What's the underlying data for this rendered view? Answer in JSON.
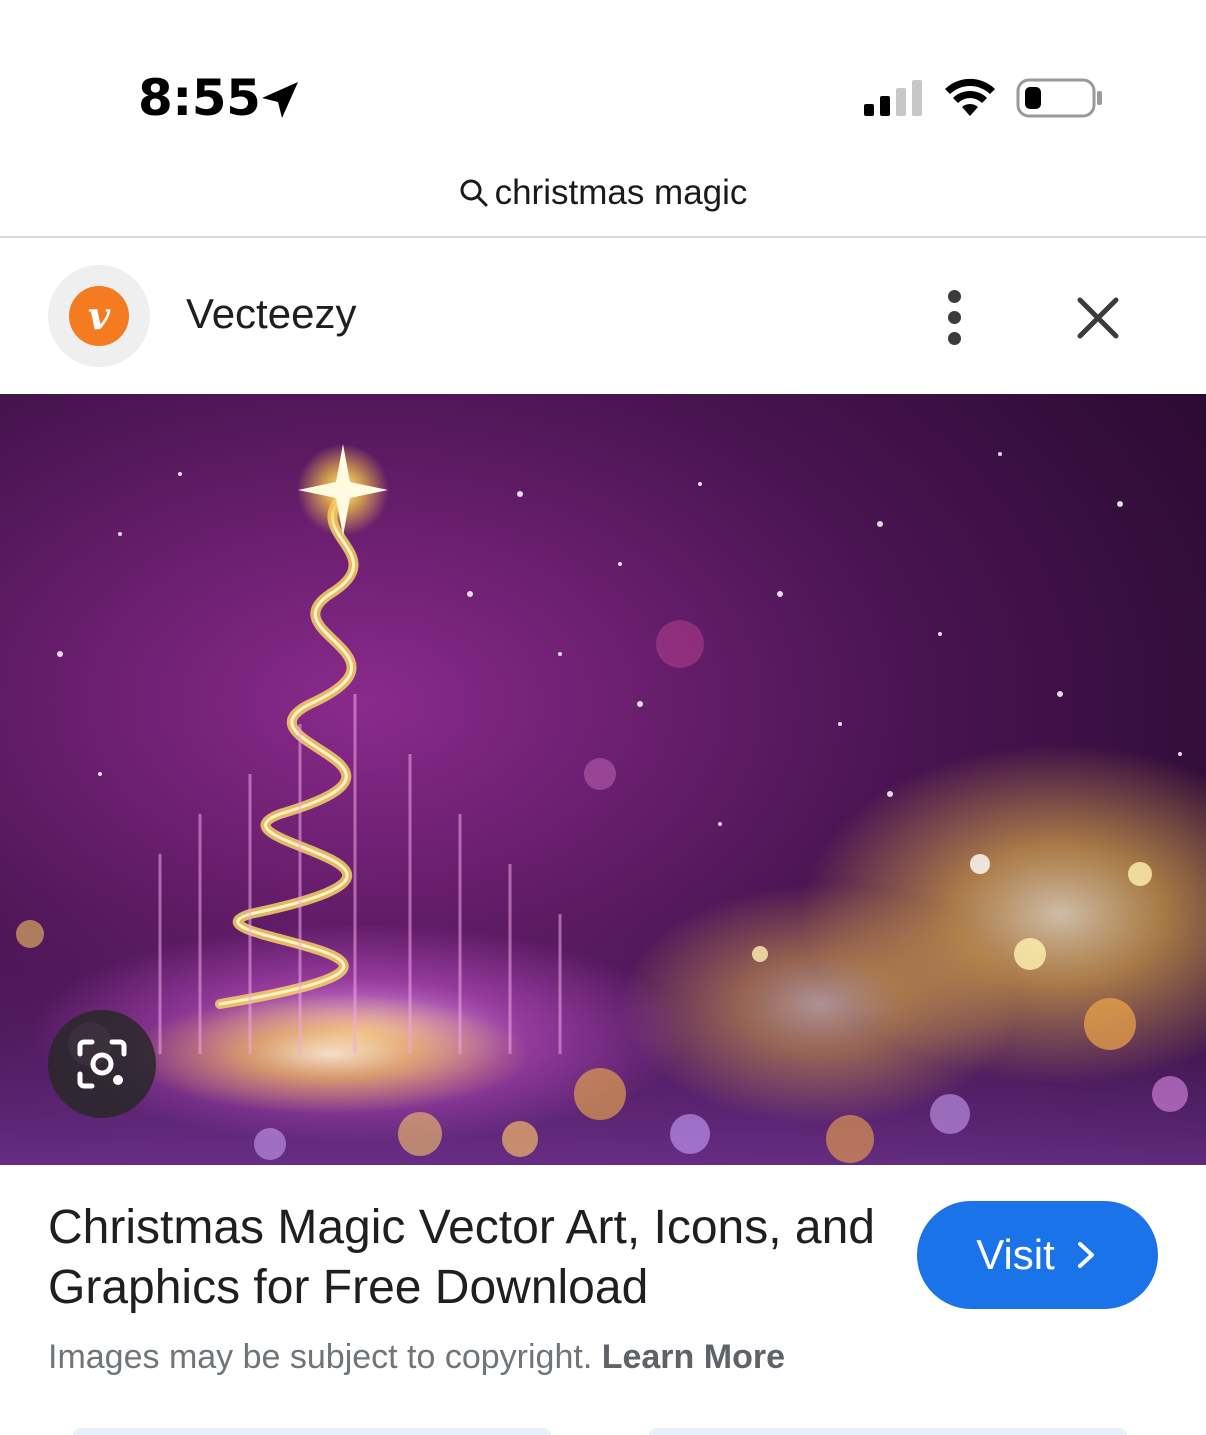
{
  "status_bar": {
    "time": "8:55"
  },
  "search": {
    "query": "christmas magic"
  },
  "source": {
    "site_name": "Vecteezy",
    "logo_letter": "v",
    "logo_color": "#f47b20"
  },
  "result": {
    "title": "Christmas Magic Vector Art, Icons, and Graphics for Free Download",
    "visit_label": "Visit",
    "copyright_text": "Images may be subject to copyright.",
    "learn_more": "Learn More"
  },
  "colors": {
    "accent": "#1a73e8",
    "hero_background": "#3a0f4a"
  }
}
